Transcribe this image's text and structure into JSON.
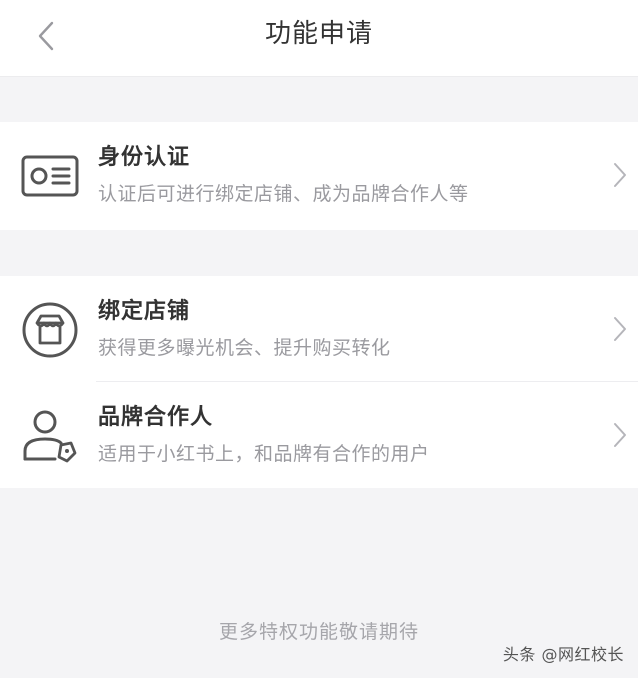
{
  "header": {
    "title": "功能申请",
    "back_icon": "chevron-left-icon"
  },
  "items": [
    {
      "icon": "id-card-icon",
      "title": "身份认证",
      "desc": "认证后可进行绑定店铺、成为品牌合作人等"
    },
    {
      "icon": "store-icon",
      "title": "绑定店铺",
      "desc": "获得更多曝光机会、提升购买转化"
    },
    {
      "icon": "user-tag-icon",
      "title": "品牌合作人",
      "desc": "适用于小红书上，和品牌有合作的用户"
    }
  ],
  "footer": {
    "note": "更多特权功能敬请期待"
  },
  "watermark": {
    "text": "头条 @网红校长"
  },
  "colors": {
    "background": "#f4f4f6",
    "card": "#ffffff",
    "title_text": "#333333",
    "secondary_text": "#9a9a9f",
    "icon_stroke": "#555555"
  }
}
